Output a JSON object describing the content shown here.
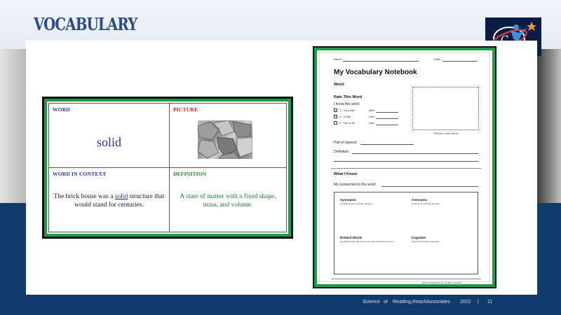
{
  "slide": {
    "title": "VOCABULARY",
    "footer": {
      "org_part1": "Science",
      "org_part2": "of",
      "org_part3": "Reading,ReachAssociates",
      "year": "2022",
      "separator": "|",
      "page": "11"
    }
  },
  "frayer": {
    "word_header": "WORD",
    "word": "solid",
    "picture_header": "PICTURE",
    "context_header": "WORD IN CONTEXT",
    "context_pre": "The brick house was a ",
    "context_highlight": "solid",
    "context_post": " structure that would stand for centuries.",
    "definition_header": "DEFINITION",
    "definition_text": "A state of matter with a fixed shape, mass, and volume."
  },
  "worksheet": {
    "name_label": "Name:",
    "date_label": "Date:",
    "title": "My Vocabulary Notebook",
    "word_label": "Word:",
    "rate_label": "Rate This Word",
    "know_label": "I know this word:",
    "options": [
      {
        "label": "1 - Very well",
        "date": "date:"
      },
      {
        "label": "2 - A little",
        "date": "date:"
      },
      {
        "label": "3 - Not at all",
        "date": "date:"
      }
    ],
    "picture_caption": "Picture of the Word",
    "part_of_speech": "Part of speech:",
    "definition": "Definition:",
    "what_i_know": "What I Know",
    "connection": "My connection to this word:",
    "synonyms": "Synonyms",
    "synonyms_sub": "words that have a similar meaning",
    "antonyms": "Antonyms",
    "antonyms_sub": "words that mean the opposite",
    "related": "Related Words",
    "related_sub": "words that share the same root or are used with the word",
    "cognates": "Cognates",
    "cognates_sub": "the word in another language",
    "copyright": "Pearson Education Inc. All rights reserved."
  },
  "colors": {
    "title": "#2a4a8a",
    "card_border": "#1f9a46",
    "word_blue": "#2233a6",
    "picture_red": "#c0261c",
    "definition_green": "#1f7d2e",
    "bottom_band": "#0f3a6a"
  }
}
